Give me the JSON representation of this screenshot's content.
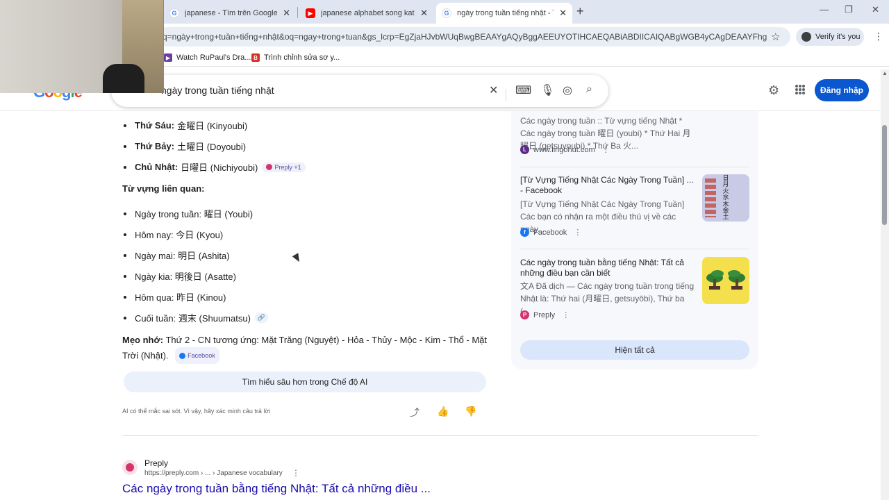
{
  "browser": {
    "tabs": [
      {
        "title": "japanese - Tìm trên Google",
        "icon": "google-icon"
      },
      {
        "title": "japanese alphabet song katakana",
        "icon": "youtube-icon"
      },
      {
        "title": "ngày trong tuần tiếng nhật - Tìm",
        "icon": "google-icon",
        "active": true
      }
    ],
    "url": "q=ngày+trong+tuần+tiếng+nhật&oq=ngay+trong+tuan&gs_lcrp=EgZjaHJvbWUqBwgBEAAYgAQyBggAEEUYOTIHCAEQABiABDIICAIQABgWGB4yCAgDEAAYFhgeMg...",
    "verify_label": "Verify it's you",
    "bookmarks": [
      {
        "label": "Watch RuPaul's Dra..."
      },
      {
        "label": "Trình chỉnh sửa sơ y..."
      }
    ]
  },
  "google": {
    "query": "ngày trong tuần tiếng nhật",
    "signin_label": "Đăng nhập"
  },
  "ai_overview": {
    "days": [
      {
        "day": "Thứ Sáu:",
        "text": "金曜日 (Kinyoubi)"
      },
      {
        "day": "Thứ Bảy:",
        "text": "土曜日 (Doyoubi)"
      },
      {
        "day": "Chủ Nhật:",
        "text": "日曜日 (Nichiyoubi)",
        "chip": "Preply +1"
      }
    ],
    "related_heading": "Từ vựng liên quan:",
    "related": [
      {
        "text": "Ngày trong tuần: 曜日 (Youbi)"
      },
      {
        "text": "Hôm nay: 今日 (Kyou)"
      },
      {
        "text": "Ngày mai: 明日 (Ashita)"
      },
      {
        "text": "Ngày kia: 明後日 (Asatte)"
      },
      {
        "text": "Hôm qua: 昨日 (Kinou)"
      },
      {
        "text": "Cuối tuần: 週末 (Shuumatsu)"
      }
    ],
    "tip_label": "Mẹo nhớ:",
    "tip_text": "Thứ 2 - CN tương ứng: Mặt Trăng (Nguyệt) - Hỏa - Thủy - Mộc - Kim - Thổ - Mặt Trời (Nhật).",
    "tip_chip": "Facebook",
    "deep_dive_label": "Tìm hiểu sâu hơn trong Chế độ AI",
    "disclaimer": "AI có thể mắc sai sót. Vì vậy, hãy xác minh câu trả lời"
  },
  "sources": [
    {
      "title": "",
      "snippet": "Các ngày trong tuần :: Từ vựng tiếng Nhật * Các ngày trong tuần 曜日 (youbi) * Thứ Hai 月曜日 (getsuyoubi) * Thứ Ba 火...",
      "site": "www.lingohut.com"
    },
    {
      "title": "[Từ Vựng Tiếng Nhật Các Ngày Trong Tuần] ... - Facebook",
      "snippet": "[Từ Vựng Tiếng Nhật Các Ngày Trong Tuần] Các bạn có nhận ra một điều thú vị về các ngày...",
      "site": "Facebook",
      "thumb_text": [
        "日",
        "月",
        "火",
        "水",
        "木",
        "金",
        "土"
      ]
    },
    {
      "title": "Các ngày trong tuần bằng tiếng Nhật: Tất cả những điều bạn cần biết",
      "snippet": "文A Đã dịch — Các ngày trong tuần trong tiếng Nhật là: Thứ hai (月曜日, getsuyōbi), Thứ ba (...",
      "site": "Preply"
    }
  ],
  "show_all_label": "Hiện tất cả",
  "result": {
    "site": "Preply",
    "url": "https://preply.com › ... › Japanese vocabulary",
    "title": "Các ngày trong tuần bằng tiếng Nhật: Tất cả những điều ..."
  },
  "colors": {
    "link": "#1a0dab",
    "primary_button": "#0b57d0",
    "tabstrip": "#dfe6f1"
  }
}
